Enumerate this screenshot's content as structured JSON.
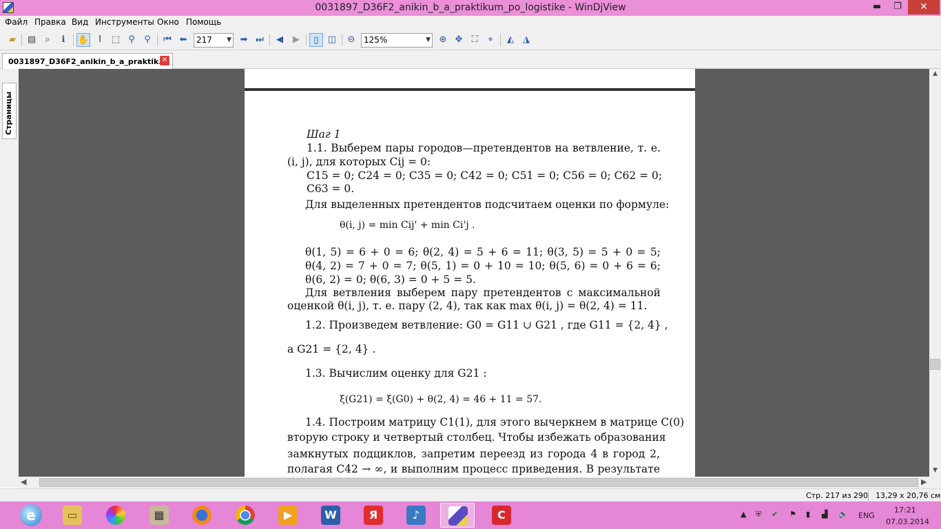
{
  "window": {
    "title": "0031897_D36F2_anikin_b_a_praktikum_po_logistike - WinDjView",
    "minimize": "▬",
    "maximize": "❐",
    "close": "✕"
  },
  "menu": [
    "Файл",
    "Правка",
    "Вид",
    "Инструменты",
    "Окно",
    "Помощь"
  ],
  "toolbar": {
    "page_number": "217",
    "zoom": "125%",
    "icons": [
      "open-icon",
      "print-icon",
      "find-icon",
      "info-icon",
      "hand-tool-icon",
      "select-tool-icon",
      "rect-select-icon",
      "zoom-in-tool-icon",
      "zoom-out-tool-icon",
      "first-page-icon",
      "previous-page-icon",
      "next-page-icon",
      "last-page-icon",
      "back-icon",
      "forward-icon",
      "single-page-icon",
      "facing-pages-icon",
      "zoom-out-icon",
      "zoom-in-icon",
      "fit-page-icon",
      "fit-width-icon",
      "actual-size-icon",
      "rotate-left-icon",
      "rotate-right-icon"
    ]
  },
  "tabs": [
    {
      "label": "0031897_D36F2_anikin_b_a_praktik...",
      "active": true
    }
  ],
  "sidebar": {
    "pages_label": "Страницы"
  },
  "status": {
    "pages": "Стр. 217 из 290",
    "size": "13,29 x 20,76 см"
  },
  "document": {
    "step": "Шаг 1",
    "l1": "1.1. Выберем пары городов—претендентов на ветвление, т. е.",
    "l2": "(i, j), для которых Cij = 0:",
    "l3": "C15 = 0;  C24 = 0;  C35 = 0;  C42 = 0;  C51 = 0;  C56 = 0;  C62 = 0;",
    "l4": "C63 = 0.",
    "l5": "Для выделенных претендентов подсчитаем оценки по формуле:",
    "formula1": "θ(i, j) = min Cij' + min Ci'j .",
    "l6": "θ(1, 5) = 6 + 0 = 6; θ(2, 4) = 5 + 6 = 11; θ(3, 5) = 5 + 0 = 5;",
    "l7": "θ(4, 2) = 7 + 0 = 7; θ(5, 1) = 0 + 10 = 10; θ(5, 6) = 0 + 6 = 6;",
    "l8": "θ(6, 2) = 0; θ(6, 3) = 0 + 5 = 5.",
    "l9": "Для ветвления выберем пару претендентов с максимальной",
    "l10": "оценкой θ(i, j), т. е. пару (2, 4), так как max θ(i, j) = θ(2, 4) = 11.",
    "l11": "1.2. Произведем ветвление: G0 = G11 ∪ G21 , где G11 = {2, 4} ,",
    "l12": "а G21 = {2, 4} .",
    "l13": "1.3. Вычислим оценку для G21 :",
    "formula2": "ξ(G21) = ξ(G0) + θ(2, 4) = 46 + 11 = 57.",
    "l14": "1.4. Построим матрицу C1(1), для этого вычеркнем в матрице C(0)",
    "l15": "вторую строку и четвертый столбец. Чтобы избежать образования",
    "l16": "замкнутых подциклов, запретим переезд из города 4 в город 2,",
    "l17": "полагая C42 → ∞, и выполним процесс приведения. В результате"
  },
  "taskbar": {
    "apps": [
      "ie-icon",
      "explorer-icon",
      "picasa-icon",
      "archive-icon",
      "firefox-icon",
      "chrome-icon",
      "media-player-icon",
      "word-icon",
      "yandex-icon",
      "audio-icon",
      "windjview-icon",
      "remote-icon"
    ],
    "lang": "ENG",
    "time": "17:21",
    "date": "07.03.2014"
  }
}
